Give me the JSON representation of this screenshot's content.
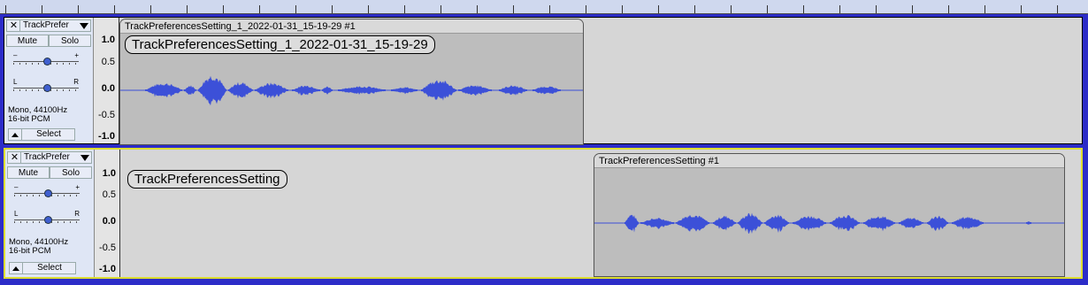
{
  "colors": {
    "waveform": "#3c50d8",
    "background": "#2c2cc8",
    "selected_border": "#dcdc30"
  },
  "tracks": [
    {
      "name": "TrackPrefer",
      "mute_label": "Mute",
      "solo_label": "Solo",
      "gain_minus": "–",
      "gain_plus": "+",
      "pan_left": "L",
      "pan_right": "R",
      "format_line1": "Mono, 44100Hz",
      "format_line2": "16-bit PCM",
      "select_label": "Select",
      "scale": [
        "1.0",
        "0.5",
        "0.0",
        "-0.5",
        "-1.0"
      ],
      "clip_title": "TrackPreferencesSetting_1_2022-01-31_15-19-29 #1",
      "label_text": "TrackPreferencesSetting_1_2022-01-31_15-19-29"
    },
    {
      "name": "TrackPrefer",
      "mute_label": "Mute",
      "solo_label": "Solo",
      "gain_minus": "–",
      "gain_plus": "+",
      "pan_left": "L",
      "pan_right": "R",
      "format_line1": "Mono, 44100Hz",
      "format_line2": "16-bit PCM",
      "select_label": "Select",
      "scale": [
        "1.0",
        "0.5",
        "0.0",
        "-0.5",
        "-1.0"
      ],
      "clip_title": "TrackPreferencesSetting #1",
      "label_text": "TrackPreferencesSetting"
    }
  ]
}
